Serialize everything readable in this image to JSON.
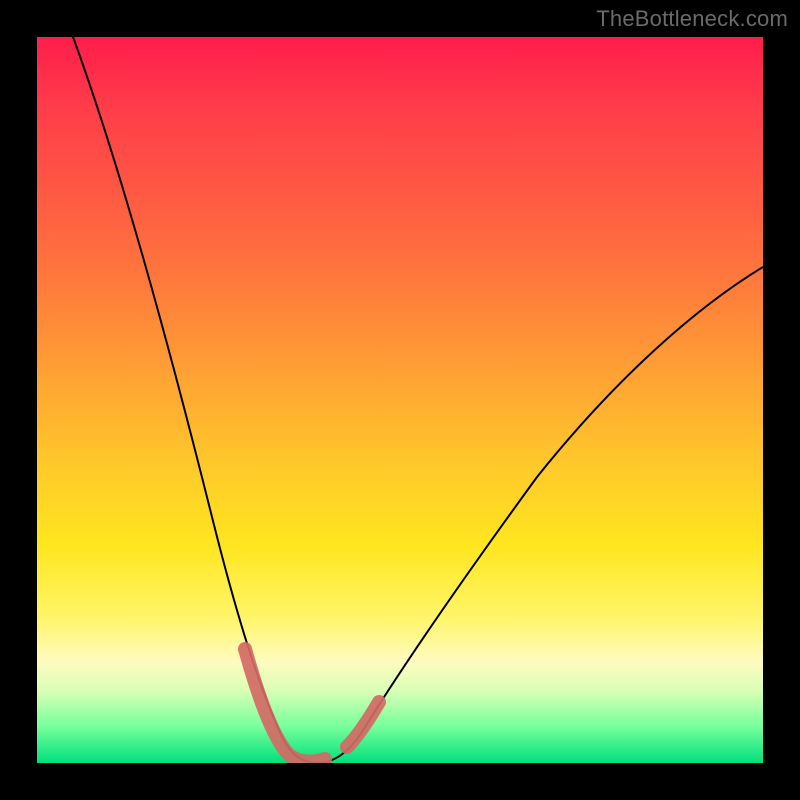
{
  "watermark": "TheBottleneck.com",
  "colors": {
    "background": "#000000",
    "gradient_top": "#ff1d4b",
    "gradient_mid": "#ffe61f",
    "gradient_bottom": "#00e07c",
    "curve": "#000000",
    "highlight": "#d36a65"
  },
  "chart_data": {
    "type": "line",
    "title": "",
    "xlabel": "",
    "ylabel": "",
    "xlim": [
      0,
      100
    ],
    "ylim": [
      0,
      100
    ],
    "grid": false,
    "series": [
      {
        "name": "bottleneck-curve",
        "x": [
          5,
          10,
          15,
          20,
          23,
          26,
          29,
          31,
          33,
          35,
          37,
          40,
          45,
          50,
          55,
          60,
          65,
          70,
          75,
          80,
          85,
          90,
          95,
          100
        ],
        "values": [
          100,
          82,
          64,
          46,
          34,
          23,
          13,
          7,
          3,
          1,
          0,
          0,
          2,
          7,
          13,
          20,
          27,
          33,
          39,
          44,
          49,
          54,
          58,
          62
        ]
      }
    ],
    "annotations": [
      {
        "name": "highlight-left",
        "x_range": [
          29,
          37
        ],
        "note": "bold points near trough left side"
      },
      {
        "name": "highlight-right",
        "x_range": [
          42,
          46
        ],
        "note": "bold points near trough right side"
      }
    ]
  }
}
